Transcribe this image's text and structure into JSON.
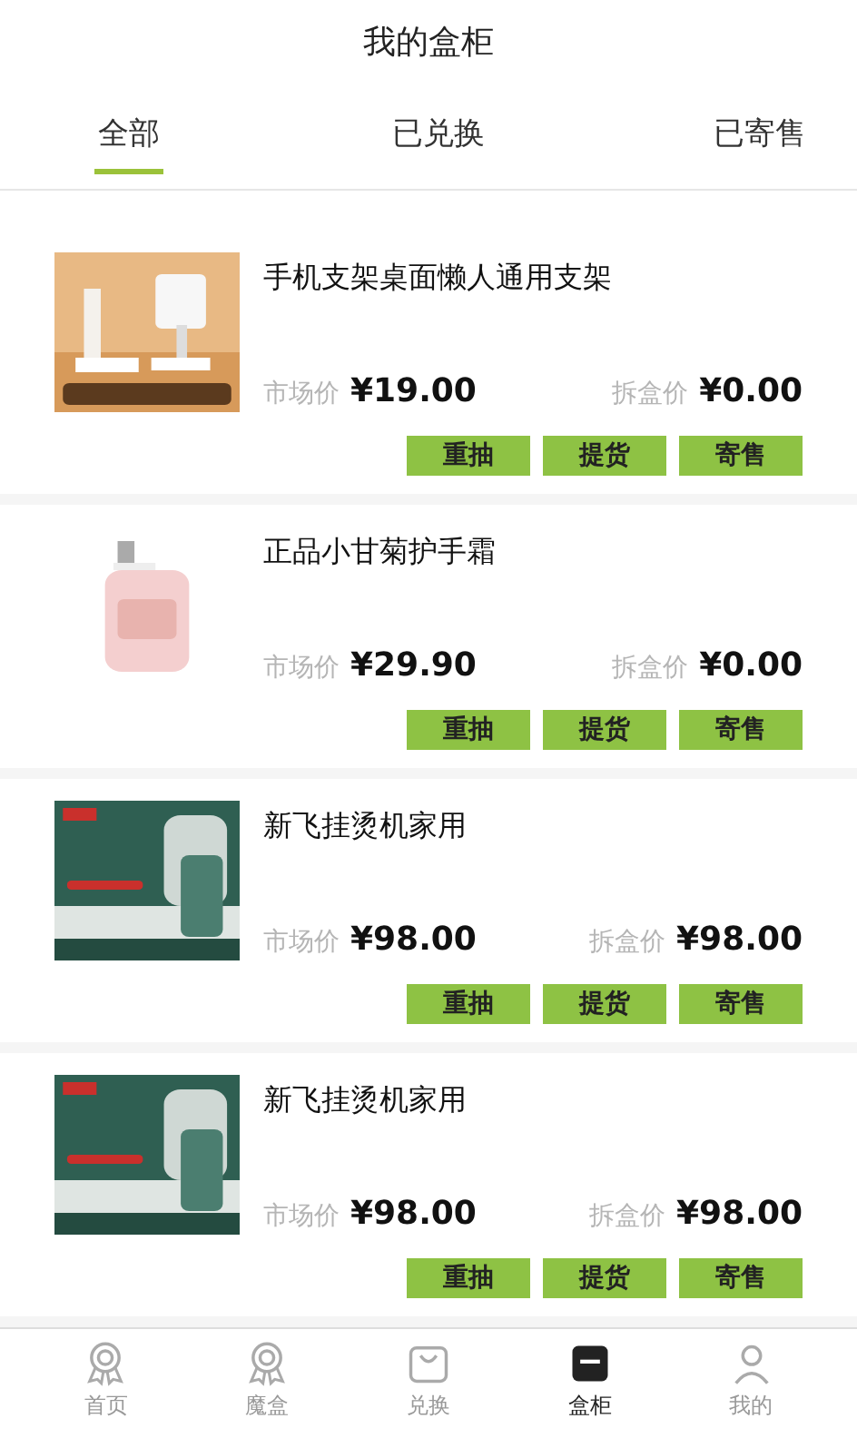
{
  "header": {
    "title": "我的盒柜"
  },
  "tabs": [
    {
      "label": "全部",
      "selected": true
    },
    {
      "label": "已兑换",
      "selected": false
    },
    {
      "label": "已寄售",
      "selected": false
    }
  ],
  "items": [
    {
      "image": {
        "kind": "picture"
      },
      "name": "手机支架桌面懒人通用支架",
      "market_label": "市场价",
      "market_price": "¥19.00",
      "box_label": "拆盒价",
      "box_price": "¥0.00",
      "actions": [
        "重抽",
        "提货",
        "寄售"
      ]
    },
    {
      "image": {
        "kind": "picture"
      },
      "name": "正品小甘菊护手霜",
      "market_label": "市场价",
      "market_price": "¥29.90",
      "box_label": "拆盒价",
      "box_price": "¥0.00",
      "actions": [
        "重抽",
        "提货",
        "寄售"
      ]
    },
    {
      "image": {
        "kind": "picture"
      },
      "name": "新飞挂烫机家用",
      "market_label": "市场价",
      "market_price": "¥98.00",
      "box_label": "拆盒价",
      "box_price": "¥98.00",
      "actions": [
        "重抽",
        "提货",
        "寄售"
      ]
    },
    {
      "image": {
        "kind": "picture"
      },
      "name": "新飞挂烫机家用",
      "market_label": "市场价",
      "market_price": "¥98.00",
      "box_label": "拆盒价",
      "box_price": "¥98.00",
      "actions": [
        "重抽",
        "提货",
        "寄售"
      ]
    }
  ],
  "nav": [
    {
      "label": "首页",
      "selected": false
    },
    {
      "label": "魔盒",
      "selected": false
    },
    {
      "label": "兑换",
      "selected": false
    },
    {
      "label": "盒柜",
      "selected": true
    },
    {
      "label": "我的",
      "selected": false
    }
  ]
}
